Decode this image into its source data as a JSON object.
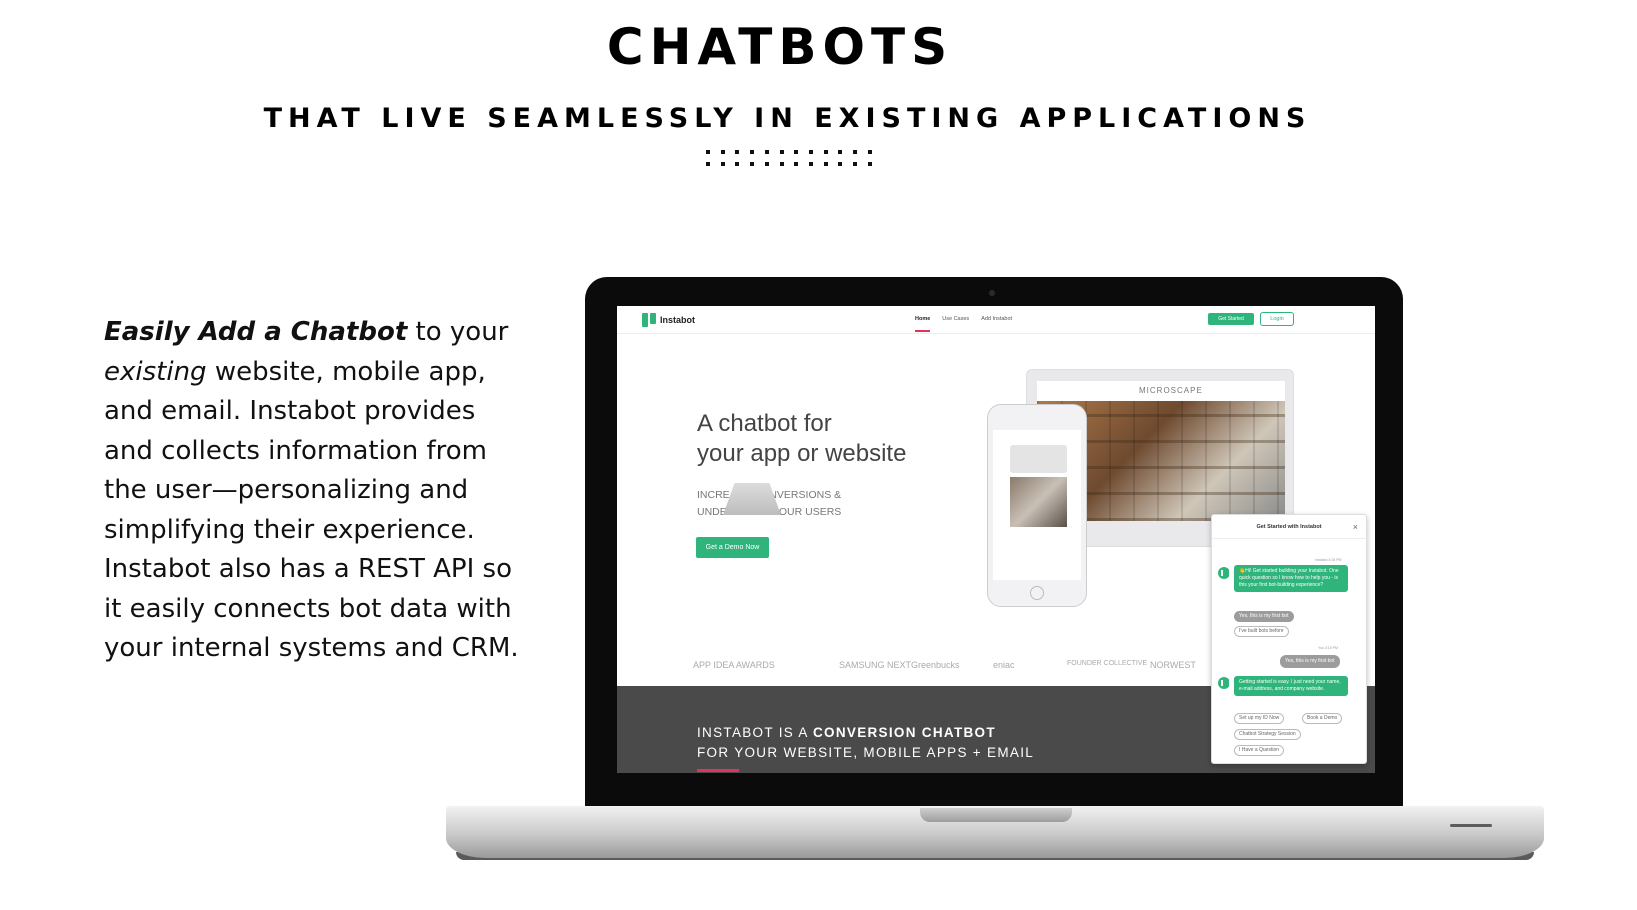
{
  "page": {
    "title": "CHATBOTS",
    "subtitle": "THAT LIVE SEAMLESSLY IN EXISTING APPLICATIONS"
  },
  "body": {
    "lead_bold": "Easily Add a Chatbot",
    "lead_rest_1": " to your",
    "lead_italic": "existing",
    "lead_rest_2": " website, mobile app, and email. Instabot provides and collects information from the user—personalizing and simplifying their experience. Instabot also has a REST API so it easily connects bot data with your internal systems and CRM."
  },
  "site": {
    "logo": "Instabot",
    "nav": [
      "Home",
      "Use Cases",
      "Add Instabot"
    ],
    "get_started": "Get Started",
    "login": "Login",
    "headline_1": "A chatbot for",
    "headline_2": "your app or website",
    "sub_1": "INCREASE CONVERSIONS &",
    "sub_2": "UNDERSTAND YOUR USERS",
    "demo_button": "Get a Demo Now",
    "imac_brand": "MICROSCAPE",
    "logos": [
      "APP IDEA AWARDS",
      "SAMSUNG NEXT",
      "Greenbucks",
      "eniac",
      "FOUNDER COLLECTIVE",
      "NORWEST"
    ],
    "banner_prefix": "INSTABOT IS A ",
    "banner_bold": "CONVERSION CHATBOT",
    "banner_line2": "FOR YOUR WEBSITE, MOBILE APPS + EMAIL"
  },
  "chat": {
    "header": "Get Started with Instabot",
    "time1": "Instabot 3:15 PM",
    "msg1": "👋Hi! Get started building your Instabot. One quick question so I know how to help you - is this your first bot-building experience?",
    "chip_yes_first": "Yes, this is my first bot",
    "chip_built_before": "I've built bots before",
    "time2": "You 3:15 PM",
    "user_reply": "Yes, this is my first bot",
    "msg2": "Getting started is easy. I just need your name, e-mail address, and company website.",
    "chips": [
      "Set up my ID Now",
      "Book a Demo",
      "Chatbot Strategy Session",
      "I Have a Question"
    ]
  },
  "colors": {
    "brand_green": "#2fb47c",
    "accent_pink": "#e2345a",
    "banner_gray": "#4a4a4a"
  }
}
